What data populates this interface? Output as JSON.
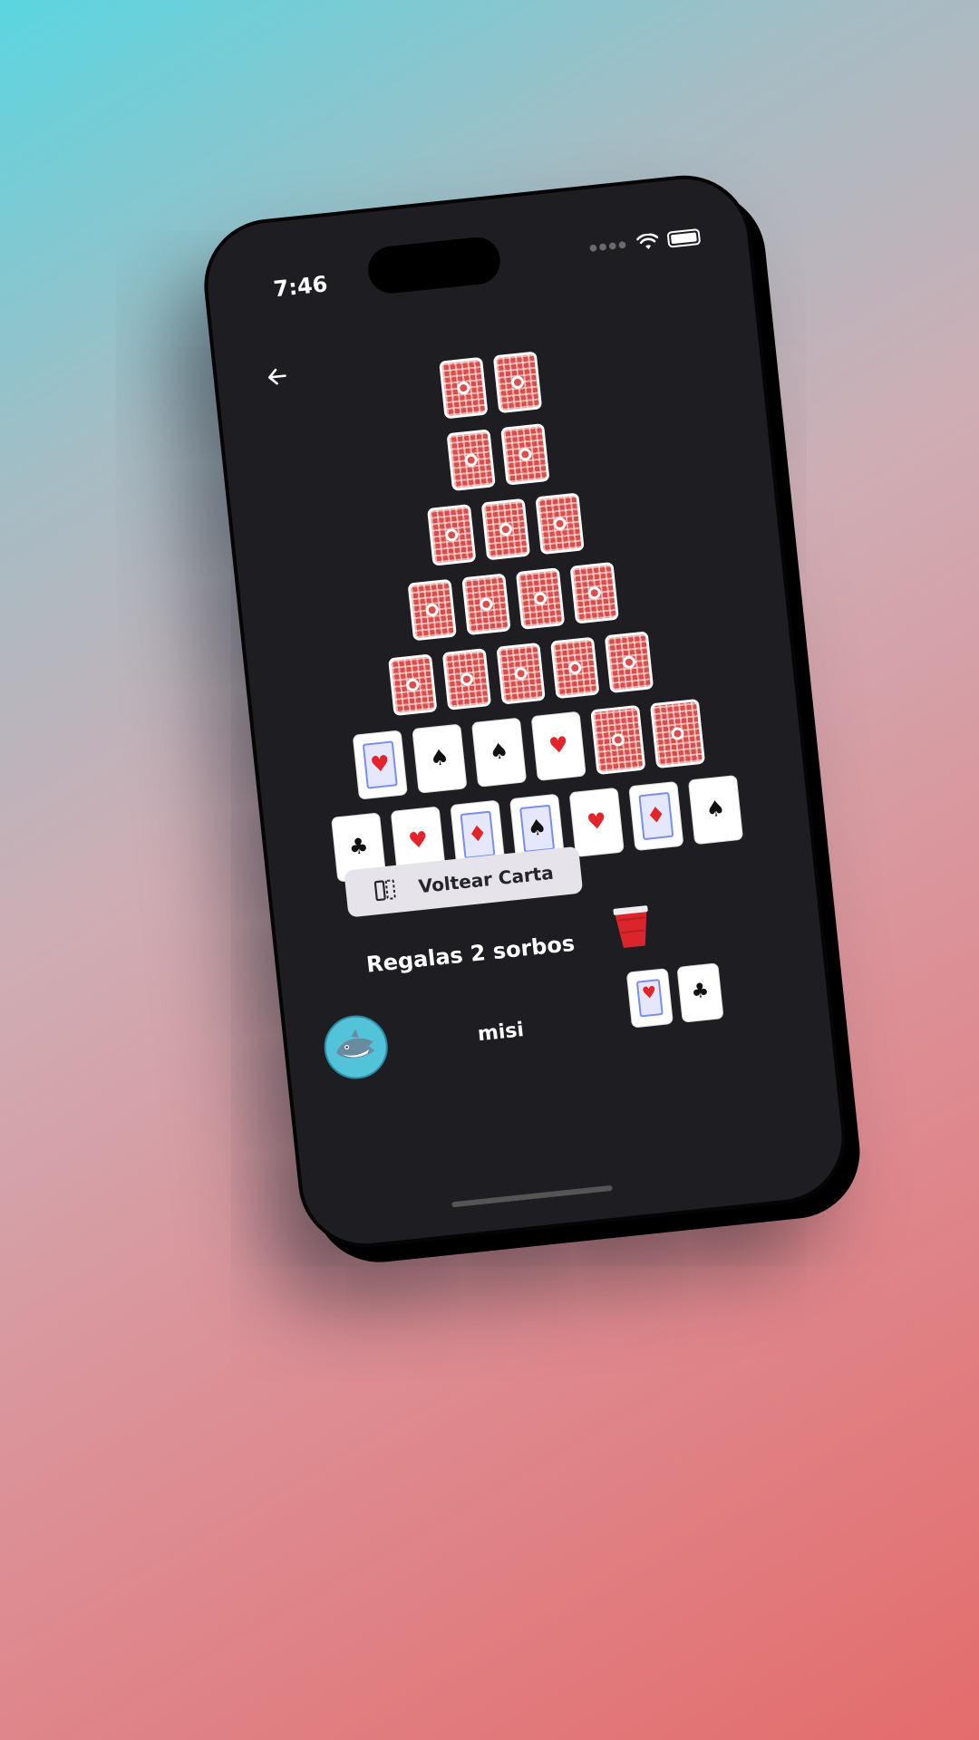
{
  "status_bar": {
    "time": "7:46"
  },
  "pyramid": {
    "rows": [
      {
        "cards": [
          {
            "facedown": true
          },
          {
            "facedown": true
          }
        ]
      },
      {
        "cards": [
          {
            "facedown": true
          },
          {
            "facedown": true
          }
        ]
      },
      {
        "cards": [
          {
            "facedown": true
          },
          {
            "facedown": true
          },
          {
            "facedown": true
          }
        ]
      },
      {
        "cards": [
          {
            "facedown": true
          },
          {
            "facedown": true
          },
          {
            "facedown": true
          },
          {
            "facedown": true
          }
        ]
      },
      {
        "cards": [
          {
            "facedown": true
          },
          {
            "facedown": true
          },
          {
            "facedown": true
          },
          {
            "facedown": true
          },
          {
            "facedown": true
          }
        ]
      },
      {
        "cards": [
          {
            "facedown": false,
            "suit": "♥",
            "color": "red",
            "court": true
          },
          {
            "facedown": false,
            "suit": "♠",
            "color": "black"
          },
          {
            "facedown": false,
            "suit": "♠",
            "color": "black"
          },
          {
            "facedown": false,
            "suit": "♥",
            "color": "red"
          },
          {
            "facedown": true
          },
          {
            "facedown": true
          }
        ]
      },
      {
        "cards": [
          {
            "facedown": false,
            "suit": "♣",
            "color": "black"
          },
          {
            "facedown": false,
            "suit": "♥",
            "color": "red"
          },
          {
            "facedown": false,
            "suit": "♦",
            "color": "red",
            "court": true
          },
          {
            "facedown": false,
            "suit": "♠",
            "color": "black",
            "court": true
          },
          {
            "facedown": false,
            "suit": "♥",
            "color": "red"
          },
          {
            "facedown": false,
            "suit": "♦",
            "color": "red",
            "court": true
          },
          {
            "facedown": false,
            "suit": "♠",
            "color": "black"
          }
        ]
      }
    ]
  },
  "actions": {
    "flip_label": "Voltear Carta"
  },
  "message": "Regalas 2 sorbos",
  "player": {
    "name": "misi",
    "hand": [
      {
        "suit": "♥",
        "color": "red",
        "court": true
      },
      {
        "suit": "♣",
        "color": "black"
      }
    ]
  },
  "colors": {
    "card_back": "#d94e4a",
    "background": "#1e1d22",
    "accent_red": "#e3242b"
  },
  "icons": {
    "back": "arrow-left-icon",
    "flip": "flip-card-icon",
    "cup": "red-cup-icon",
    "avatar": "shark-avatar-icon"
  }
}
